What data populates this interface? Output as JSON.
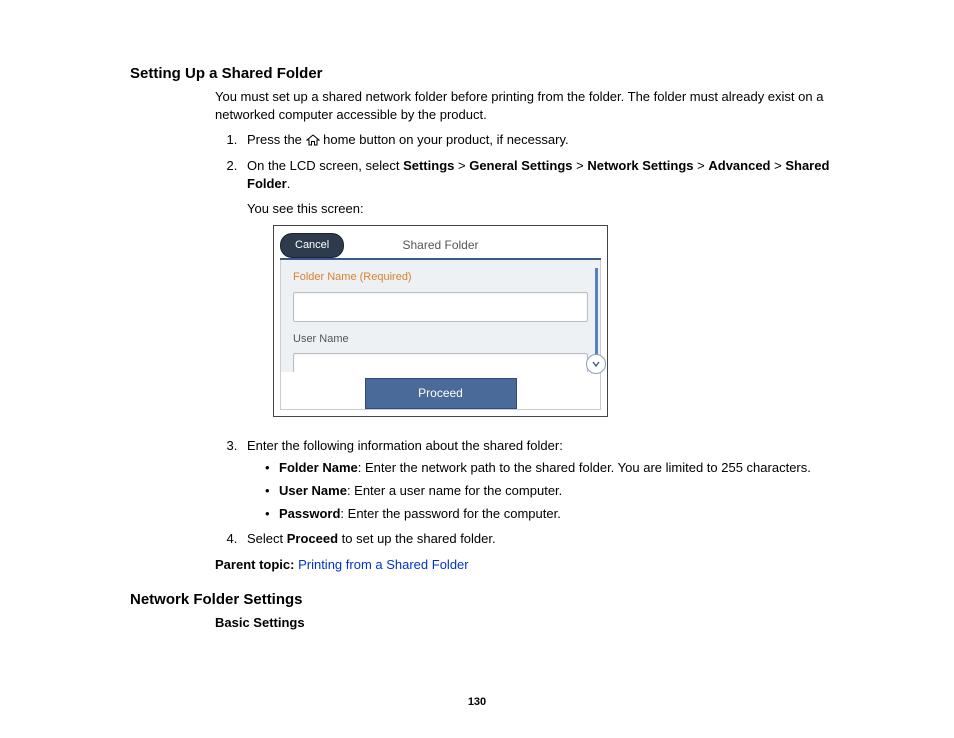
{
  "section1": {
    "heading": "Setting Up a Shared Folder",
    "intro": "You must set up a shared network folder before printing from the folder. The folder must already exist on a networked computer accessible by the product.",
    "step1_pre": "Press the ",
    "step1_post": " home button on your product, if necessary.",
    "step2_pre": "On the LCD screen, select ",
    "nav": {
      "a": "Settings",
      "b": "General Settings",
      "c": "Network Settings",
      "d": "Advanced",
      "e": "Shared Folder"
    },
    "sep": " > ",
    "period": ".",
    "screen_note": "You see this screen:",
    "lcd": {
      "cancel": "Cancel",
      "title": "Shared Folder",
      "field1": "Folder Name (Required)",
      "field2": "User Name",
      "proceed": "Proceed"
    },
    "step3_intro": "Enter the following information about the shared folder:",
    "bullets": {
      "b1_label": "Folder Name",
      "b1_text": ": Enter the network path to the shared folder. You are limited to 255 characters.",
      "b2_label": "User Name",
      "b2_text": ": Enter a user name for the computer.",
      "b3_label": "Password",
      "b3_text": ": Enter the password for the computer."
    },
    "step4_pre": "Select ",
    "step4_bold": "Proceed",
    "step4_post": " to set up the shared folder.",
    "parent_label": "Parent topic: ",
    "parent_link": "Printing from a Shared Folder"
  },
  "section2": {
    "heading": "Network Folder Settings",
    "sub": "Basic Settings"
  },
  "page_number": "130"
}
